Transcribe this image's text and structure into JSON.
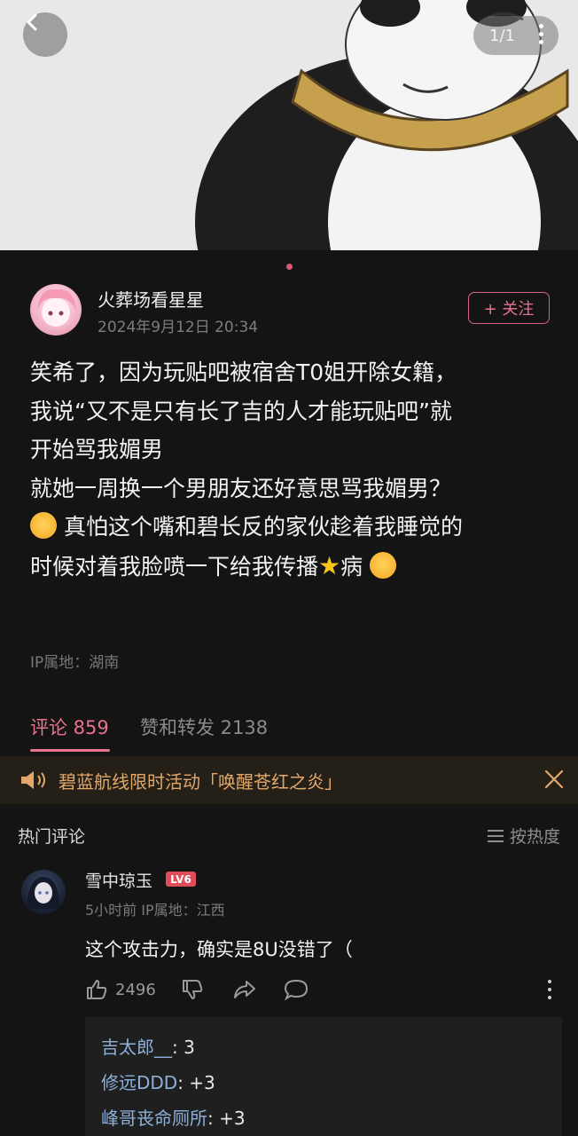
{
  "viewer": {
    "back_icon": "chevron-left-icon",
    "pager": "1/1",
    "more_icon": "vertical-dots-icon"
  },
  "post": {
    "author": {
      "name": "火葬场看星星",
      "time": "2024年9月12日 20:34",
      "follow_label": "+ 关注"
    },
    "lines": [
      "笑希了，因为玩贴吧被宿舍T0姐开除女籍，",
      "我说“又不是只有长了吉的人才能玩贴吧”就",
      "开始骂我媚男",
      "就她一周换一个男朋友还好意思骂我媚男？"
    ],
    "line5": "真怕这个嘴和碧长反的家伙趁着我睡觉的",
    "line6a": "时候对着我脸喷一下给我传播",
    "line6b": "病",
    "ip": "IP属地：湖南"
  },
  "tabs": {
    "comments": "评论 859",
    "likes_forwards": "赞和转发 2138"
  },
  "banner": {
    "text": "碧蓝航线限时活动「唤醒苍红之炎」"
  },
  "comments": {
    "section_title": "热门评论",
    "sort_label": "按热度",
    "items": [
      {
        "name": "雪中琼玉",
        "level": "LV6",
        "time": "5小时前",
        "ip": "IP属地：江西",
        "text": "这个攻击力，确实是8U没错了（",
        "likes": "2496",
        "replies": [
          {
            "name": "吉太郎__",
            "text": ": 3"
          },
          {
            "name": "修远DDD",
            "text": ": +3"
          },
          {
            "name": "峰哥丧命厕所",
            "text": ": +3"
          }
        ]
      }
    ]
  },
  "colors": {
    "accent": "#e8738d",
    "background": "#141414",
    "banner_text": "#e2a869",
    "reply_name": "#8db0d9"
  }
}
